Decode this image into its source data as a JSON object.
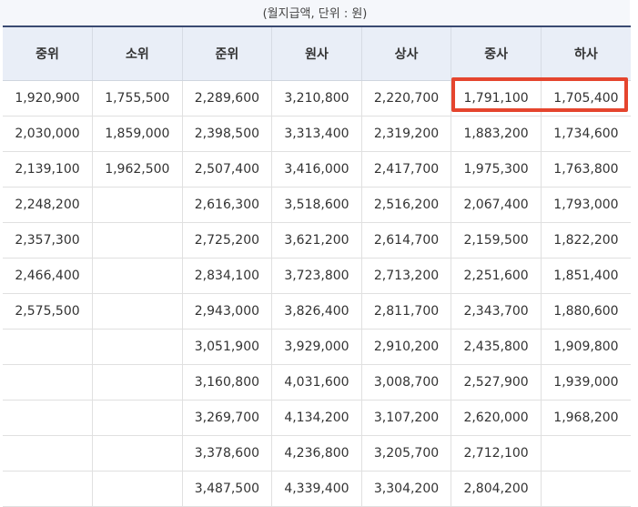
{
  "caption": "(월지급액, 단위 : 원)",
  "highlight_color": "#e5452e",
  "table": {
    "headers": [
      "중위",
      "소위",
      "준위",
      "원사",
      "상사",
      "중사",
      "하사"
    ],
    "rows": [
      [
        "1,920,900",
        "1,755,500",
        "2,289,600",
        "3,210,800",
        "2,220,700",
        "1,791,100",
        "1,705,400"
      ],
      [
        "2,030,000",
        "1,859,000",
        "2,398,500",
        "3,313,400",
        "2,319,200",
        "1,883,200",
        "1,734,600"
      ],
      [
        "2,139,100",
        "1,962,500",
        "2,507,400",
        "3,416,000",
        "2,417,700",
        "1,975,300",
        "1,763,800"
      ],
      [
        "2,248,200",
        "",
        "2,616,300",
        "3,518,600",
        "2,516,200",
        "2,067,400",
        "1,793,000"
      ],
      [
        "2,357,300",
        "",
        "2,725,200",
        "3,621,200",
        "2,614,700",
        "2,159,500",
        "1,822,200"
      ],
      [
        "2,466,400",
        "",
        "2,834,100",
        "3,723,800",
        "2,713,200",
        "2,251,600",
        "1,851,400"
      ],
      [
        "2,575,500",
        "",
        "2,943,000",
        "3,826,400",
        "2,811,700",
        "2,343,700",
        "1,880,600"
      ],
      [
        "",
        "",
        "3,051,900",
        "3,929,000",
        "2,910,200",
        "2,435,800",
        "1,909,800"
      ],
      [
        "",
        "",
        "3,160,800",
        "4,031,600",
        "3,008,700",
        "2,527,900",
        "1,939,000"
      ],
      [
        "",
        "",
        "3,269,700",
        "4,134,200",
        "3,107,200",
        "2,620,000",
        "1,968,200"
      ],
      [
        "",
        "",
        "3,378,600",
        "4,236,800",
        "3,205,700",
        "2,712,100",
        ""
      ],
      [
        "",
        "",
        "3,487,500",
        "4,339,400",
        "3,304,200",
        "2,804,200",
        ""
      ]
    ]
  }
}
